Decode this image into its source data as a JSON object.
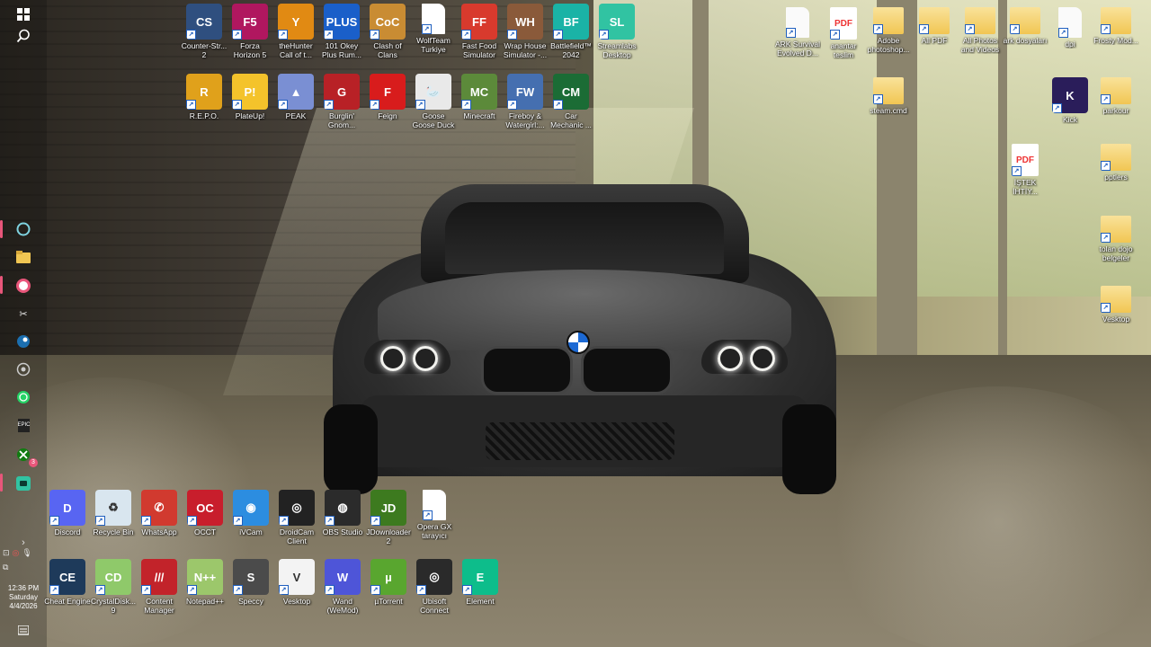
{
  "taskbar": {
    "clock_time": "12:36 PM",
    "clock_day": "Saturday",
    "clock_date": "4/4/2026",
    "xbox_badge": "3",
    "colors": {
      "indicator": "#e8567a"
    }
  },
  "desktop": {
    "top_rows": [
      {
        "label": "Counter-Str... 2",
        "icon": "cs2-icon",
        "color": "#2f4f7f",
        "glyph": "CS"
      },
      {
        "label": "Forza Horizon 5",
        "icon": "forza-icon",
        "color": "#b0175f",
        "glyph": "F5"
      },
      {
        "label": "theHunter Call of t...",
        "icon": "thehunter-icon",
        "color": "#e18a13",
        "glyph": "Y"
      },
      {
        "label": "101 Okey Plus Rum...",
        "icon": "okey-icon",
        "color": "#1a5fc9",
        "glyph": "PLUS"
      },
      {
        "label": "Clash of Clans",
        "icon": "coc-icon",
        "color": "#c98c33",
        "glyph": "CoC"
      },
      {
        "label": "WolfTeam Turkiye",
        "icon": "file-icon",
        "color": "#ffffff",
        "glyph": ""
      },
      {
        "label": "Fast Food Simulator",
        "icon": "fastfood-icon",
        "color": "#d83a2d",
        "glyph": "FF"
      },
      {
        "label": "Wrap House Simulator -...",
        "icon": "wraphouse-icon",
        "color": "#8a5a3a",
        "glyph": "WH"
      },
      {
        "label": "Battlefield™ 2042",
        "icon": "battlefield-icon",
        "color": "#1ab3a6",
        "glyph": "BF"
      },
      {
        "label": "Streamlabs Desktop",
        "icon": "streamlabs-icon",
        "color": "#31c3a2",
        "glyph": "SL"
      }
    ],
    "second_row": [
      {
        "label": "R.E.P.O.",
        "icon": "repo-icon",
        "color": "#e0a11b",
        "glyph": "R"
      },
      {
        "label": "PlateUp!",
        "icon": "plateup-icon",
        "color": "#f4c32b",
        "glyph": "P!"
      },
      {
        "label": "PEAK",
        "icon": "peak-icon",
        "color": "#7a8fd3",
        "glyph": "▲"
      },
      {
        "label": "Burglin' Gnom...",
        "icon": "burglin-icon",
        "color": "#b82126",
        "glyph": "G"
      },
      {
        "label": "Feign",
        "icon": "feign-icon",
        "color": "#d81c1c",
        "glyph": "F"
      },
      {
        "label": "Goose Goose Duck",
        "icon": "goose-icon",
        "color": "#e9e9e9",
        "glyph": "🦢"
      },
      {
        "label": "Minecraft",
        "icon": "minecraft-icon",
        "color": "#5c8a3a",
        "glyph": "MC"
      },
      {
        "label": "Fireboy & Watergirl:...",
        "icon": "fireboy-icon",
        "color": "#456fb0",
        "glyph": "FW"
      },
      {
        "label": "Car Mechanic ...",
        "icon": "carmechanic-icon",
        "color": "#1b6c35",
        "glyph": "CM"
      }
    ],
    "right_column_top": [
      {
        "label": "ARK Survival Evolved D...",
        "icon": "file-icon",
        "kind": "file"
      },
      {
        "label": "anantar teslim",
        "icon": "pdf-icon",
        "kind": "pdf"
      },
      {
        "label": "Adobe photoshop...",
        "icon": "folder-icon",
        "kind": "folder"
      },
      {
        "label": "All PDF",
        "icon": "folder-icon",
        "kind": "folder"
      },
      {
        "label": "All Photos and Videos",
        "icon": "folder-icon",
        "kind": "folder"
      },
      {
        "label": "ark dosyaları",
        "icon": "folder-icon",
        "kind": "folder"
      },
      {
        "label": "dpi",
        "icon": "file-icon",
        "kind": "file"
      },
      {
        "label": "Frosty Mod...",
        "icon": "folder-icon",
        "kind": "folder"
      }
    ],
    "right_column_misc": [
      {
        "label": "steam.cmd",
        "icon": "folder-icon",
        "kind": "folder"
      },
      {
        "label": "Kick",
        "icon": "kick-icon",
        "kind": "app"
      },
      {
        "label": "parkour",
        "icon": "folder-icon",
        "kind": "folder"
      },
      {
        "label": "İŞTEK İHTİY...",
        "icon": "pdf-icon",
        "kind": "pdf"
      },
      {
        "label": "pptlers",
        "icon": "folder-icon",
        "kind": "folder"
      },
      {
        "label": "tolan dojo belgeler",
        "icon": "folder-icon",
        "kind": "folder"
      },
      {
        "label": "Vesktop",
        "icon": "folder-icon",
        "kind": "folder"
      }
    ],
    "bottom_row1": [
      {
        "label": "Discord",
        "icon": "discord-icon",
        "color": "#5865f2",
        "glyph": "D"
      },
      {
        "label": "Recycle Bin",
        "icon": "recycle-bin-icon",
        "color": "#d9e6ef",
        "glyph": "♻"
      },
      {
        "label": "WhatsApp",
        "icon": "whatsapp-icon",
        "color": "#d13a2f",
        "glyph": "✆"
      },
      {
        "label": "OCCT",
        "icon": "occt-icon",
        "color": "#c81e2c",
        "glyph": "OC"
      },
      {
        "label": "iVCam",
        "icon": "ivcam-icon",
        "color": "#2c8de0",
        "glyph": "◉"
      },
      {
        "label": "DroidCam Client",
        "icon": "droidcam-icon",
        "color": "#222222",
        "glyph": "◎"
      },
      {
        "label": "OBS Studio",
        "icon": "obs-icon",
        "color": "#2b2b2b",
        "glyph": "◍"
      },
      {
        "label": "JDownloader 2",
        "icon": "jdownloader-icon",
        "color": "#3d7a1f",
        "glyph": "JD"
      },
      {
        "label": "Opera GX tarayıcı",
        "icon": "file-icon",
        "color": "#ffffff",
        "glyph": ""
      }
    ],
    "bottom_row2": [
      {
        "label": "Cheat Engine",
        "icon": "cheatengine-icon",
        "color": "#1e3a5a",
        "glyph": "CE"
      },
      {
        "label": "CrystalDisk... 9",
        "icon": "crystaldisk-icon",
        "color": "#8fc96a",
        "glyph": "CD"
      },
      {
        "label": "Content Manager",
        "icon": "contentmanager-icon",
        "color": "#c2232a",
        "glyph": "///"
      },
      {
        "label": "Notepad++",
        "icon": "notepadpp-icon",
        "color": "#9cc76b",
        "glyph": "N++"
      },
      {
        "label": "Speccy",
        "icon": "speccy-icon",
        "color": "#4b4b4b",
        "glyph": "S"
      },
      {
        "label": "Vesktop",
        "icon": "vesktop-icon",
        "color": "#f3f3f3",
        "glyph": "V"
      },
      {
        "label": "Wand (WeMod)",
        "icon": "wand-icon",
        "color": "#4e55d8",
        "glyph": "W"
      },
      {
        "label": "µTorrent",
        "icon": "utorrent-icon",
        "color": "#59a62f",
        "glyph": "µ"
      },
      {
        "label": "Ubisoft Connect",
        "icon": "ubisoft-icon",
        "color": "#2a2a2a",
        "glyph": "◎"
      },
      {
        "label": "Element",
        "icon": "element-icon",
        "color": "#0dbd8b",
        "glyph": "E"
      }
    ]
  }
}
